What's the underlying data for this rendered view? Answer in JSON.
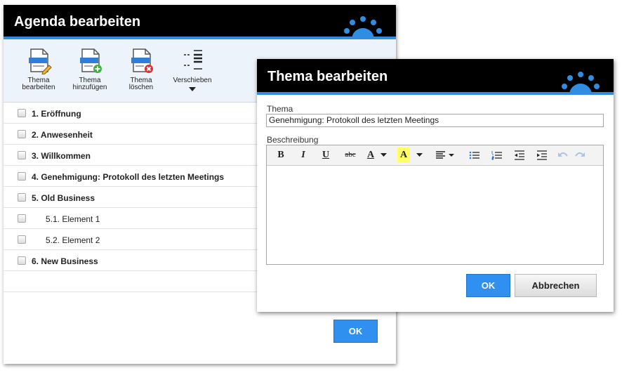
{
  "agenda": {
    "title": "Agenda bearbeiten",
    "toolbar": {
      "edit": {
        "line1": "Thema",
        "line2": "bearbeiten"
      },
      "add": {
        "line1": "Thema",
        "line2": "hinzufügen"
      },
      "delete": {
        "line1": "Thema",
        "line2": "löschen"
      },
      "move": {
        "label": "Verschieben"
      }
    },
    "items": [
      {
        "label": "1. Eröffnung"
      },
      {
        "label": "2. Anwesenheit"
      },
      {
        "label": "3. Willkommen"
      },
      {
        "label": "4. Genehmigung: Protokoll des letzten Meetings"
      },
      {
        "label": "5. Old Business"
      },
      {
        "label": "5.1. Element 1"
      },
      {
        "label": "5.2. Element 2"
      },
      {
        "label": "6. New Business"
      }
    ],
    "ok_label": "OK"
  },
  "dialog": {
    "title": "Thema bearbeiten",
    "topic_label": "Thema",
    "topic_value": "Genehmigung: Protokoll des letzten Meetings",
    "description_label": "Beschreibung",
    "editor_toolbar": {
      "bold": "B",
      "italic": "I",
      "underline": "U",
      "strike": "abc",
      "font_color": "A",
      "highlight": "A"
    },
    "ok_label": "OK",
    "cancel_label": "Abbrechen"
  },
  "colors": {
    "accent": "#2f90ef",
    "titlebar": "#000000",
    "toolbar_bg": "#edf3fb",
    "highlight_yellow": "#ffff66"
  },
  "icons": {
    "edit": "document-pencil-icon",
    "add": "document-plus-icon",
    "delete": "document-x-icon",
    "move": "move-lines-icon"
  }
}
